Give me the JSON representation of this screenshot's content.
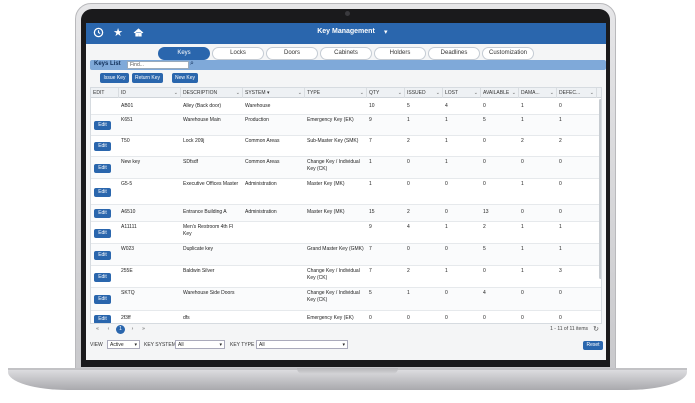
{
  "header": {
    "title": "Key Management",
    "icons": [
      "clock-icon",
      "star-icon",
      "home-icon"
    ],
    "caret": "▾",
    "color": "#2a66ad"
  },
  "tabs": [
    "Keys",
    "Locks",
    "Doors",
    "Cabinets",
    "Holders",
    "Deadlines",
    "Customization"
  ],
  "active_tab": "Keys",
  "keylist": {
    "label": "Keys List",
    "search_placeholder": "Find...",
    "search_icon": "search-icon",
    "buttons": [
      "Issue Key",
      "Return Key",
      "New Key"
    ]
  },
  "table": {
    "columns": [
      "EDIT",
      "ID",
      "DESCRIPTION",
      "SYSTEM ▾",
      "TYPE",
      "QTY",
      "ISSUED",
      "LOST",
      "AVAILABLE",
      "DAMA...",
      "DEFEC..."
    ],
    "edit_label": "Edit",
    "rows": [
      {
        "id": "AB01",
        "desc": "Alley (Back door)",
        "system": "Warehouse",
        "type": "",
        "qty": "10",
        "issued": "5",
        "lost": "4",
        "available": "0",
        "damaged": "1",
        "defective": "0",
        "edit": false
      },
      {
        "id": "K651",
        "desc": "Warehouse Main",
        "system": "Production",
        "type": "Emergency Key (EK)",
        "qty": "9",
        "issued": "1",
        "lost": "1",
        "available": "5",
        "damaged": "1",
        "defective": "1",
        "edit": true
      },
      {
        "id": "T50",
        "desc": "Lock 209j",
        "system": "Common Areas",
        "type": "Sub-Master Key (SMK)",
        "qty": "7",
        "issued": "2",
        "lost": "1",
        "available": "0",
        "damaged": "2",
        "defective": "2",
        "edit": true
      },
      {
        "id": "New key",
        "desc": "SDfsdf",
        "system": "Common Areas",
        "type": "Change Key / Individual Key (CK)",
        "qty": "1",
        "issued": "0",
        "lost": "1",
        "available": "0",
        "damaged": "0",
        "defective": "0",
        "edit": true
      },
      {
        "id": "G5-5",
        "desc": "Executive Offices Master",
        "system": "Administration",
        "type": "Master Key (MK)",
        "qty": "1",
        "issued": "0",
        "lost": "0",
        "available": "0",
        "damaged": "1",
        "defective": "0",
        "edit": true
      },
      {
        "id": "A6510",
        "desc": "Entrance Building A",
        "system": "Administration",
        "type": "Master Key (MK)",
        "qty": "15",
        "issued": "2",
        "lost": "0",
        "available": "13",
        "damaged": "0",
        "defective": "0",
        "edit": true
      },
      {
        "id": "A11111",
        "desc": "Men's Restroom 4th Fl Key",
        "system": "",
        "type": "",
        "qty": "9",
        "issued": "4",
        "lost": "1",
        "available": "2",
        "damaged": "1",
        "defective": "1",
        "edit": true
      },
      {
        "id": "W023",
        "desc": "Duplicate key",
        "system": "",
        "type": "Grand Master Key (GMK)",
        "qty": "7",
        "issued": "0",
        "lost": "0",
        "available": "5",
        "damaged": "1",
        "defective": "1",
        "edit": true
      },
      {
        "id": "255E",
        "desc": "Baldwin Silver",
        "system": "",
        "type": "Change Key / Individual Key (CK)",
        "qty": "7",
        "issued": "2",
        "lost": "1",
        "available": "0",
        "damaged": "1",
        "defective": "3",
        "edit": true
      },
      {
        "id": "SKTQ",
        "desc": "Warehouse Side Doors",
        "system": "",
        "type": "Change Key / Individual Key (CK)",
        "qty": "5",
        "issued": "1",
        "lost": "0",
        "available": "4",
        "damaged": "0",
        "defective": "0",
        "edit": true
      },
      {
        "id": "2f3ff",
        "desc": "dfs",
        "system": "",
        "type": "Emergency Key (EK)",
        "qty": "0",
        "issued": "0",
        "lost": "0",
        "available": "0",
        "damaged": "0",
        "defective": "0",
        "edit": true
      }
    ]
  },
  "pager": {
    "first": "«",
    "prev": "‹",
    "current": "1",
    "next": "›",
    "last": "»",
    "info": "1 - 11 of 11 items",
    "refresh": "↻"
  },
  "filters": {
    "view_label": "VIEW",
    "view_value": "Active",
    "system_label": "KEY SYSTEM",
    "system_value": "All",
    "type_label": "KEY TYPE",
    "type_value": "All",
    "reset_label": "Reset"
  }
}
